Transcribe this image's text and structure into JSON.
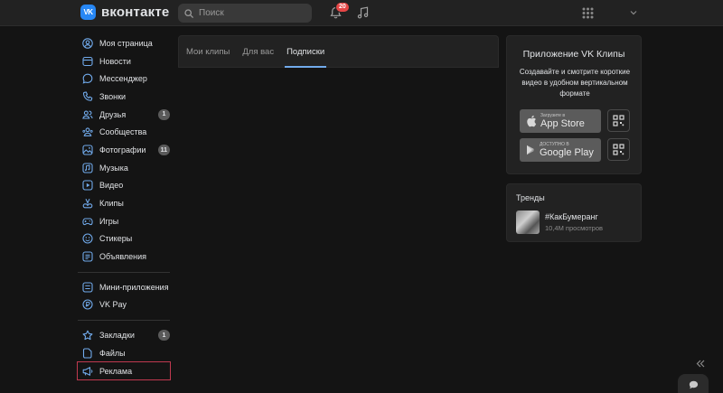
{
  "header": {
    "logo_text": "вконтакте",
    "search_placeholder": "Поиск",
    "notifications_count": "20"
  },
  "sidebar": {
    "groups": [
      [
        {
          "label": "Моя страница",
          "icon": "user-circle-icon"
        },
        {
          "label": "Новости",
          "icon": "newspaper-icon"
        },
        {
          "label": "Мессенджер",
          "icon": "message-icon"
        },
        {
          "label": "Звонки",
          "icon": "phone-icon"
        },
        {
          "label": "Друзья",
          "icon": "users-icon",
          "badge": "1"
        },
        {
          "label": "Сообщества",
          "icon": "community-icon"
        },
        {
          "label": "Фотографии",
          "icon": "photo-icon",
          "badge": "11"
        },
        {
          "label": "Музыка",
          "icon": "music-icon"
        },
        {
          "label": "Видео",
          "icon": "video-icon"
        },
        {
          "label": "Клипы",
          "icon": "clips-icon"
        },
        {
          "label": "Игры",
          "icon": "gamepad-icon"
        },
        {
          "label": "Стикеры",
          "icon": "sticker-icon"
        },
        {
          "label": "Объявления",
          "icon": "ads-board-icon"
        }
      ],
      [
        {
          "label": "Мини-приложения",
          "icon": "mini-apps-icon"
        },
        {
          "label": "VK Pay",
          "icon": "vkpay-icon"
        }
      ],
      [
        {
          "label": "Закладки",
          "icon": "star-icon",
          "badge": "1"
        },
        {
          "label": "Файлы",
          "icon": "file-icon"
        },
        {
          "label": "Реклама",
          "icon": "megaphone-icon"
        }
      ]
    ]
  },
  "main": {
    "tabs": [
      {
        "label": "Мои клипы",
        "active": false
      },
      {
        "label": "Для вас",
        "active": false
      },
      {
        "label": "Подписки",
        "active": true
      }
    ]
  },
  "promo": {
    "title": "Приложение VK Клипы",
    "description": "Создавайте и смотрите короткие видео в удобном вертикальном формате",
    "appstore_sub": "Загрузите в",
    "appstore_main": "App Store",
    "googleplay_sub": "ДОСТУПНО В",
    "googleplay_main": "Google Play"
  },
  "trends": {
    "title": "Тренды",
    "items": [
      {
        "name": "#КакБумеранг",
        "views": "10,4М просмотров"
      }
    ]
  },
  "colors": {
    "background": "#141414",
    "panel": "#222222",
    "accent": "#2787f5",
    "tab_underline": "#71aaeb",
    "badge_red": "#e64646",
    "highlight_border": "#c0394f"
  }
}
